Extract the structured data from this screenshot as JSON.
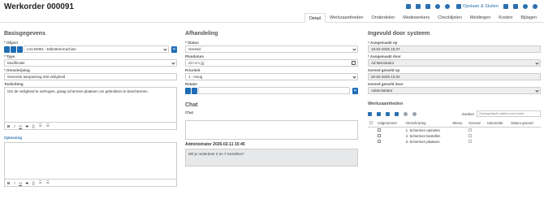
{
  "header": {
    "title": "Werkorder 000091",
    "save_label": "Opslaan & Sluiten",
    "icons": [
      "list-icon",
      "print-icon",
      "mail-icon",
      "phone-icon",
      "check-icon",
      "save-icon",
      "delete-icon",
      "undo-icon",
      "refresh-icon"
    ]
  },
  "tabs": [
    "Detail",
    "Werkzaamheden",
    "Onderdelen",
    "Medewerkers",
    "Checklijsten",
    "Meldingen",
    "Kosten",
    "Bijlagen"
  ],
  "basis": {
    "heading": "Basisgegevens",
    "object_label": "Object",
    "object_value": "L01-EM01 - Etiketteermachine",
    "type_label": "Type",
    "type_value": "Modificatie",
    "omschrijving_label": "Omschrijving",
    "omschrijving_value": "Geverste aanpassing mbt veiligheid",
    "toelichting_label": "Toelichting",
    "toelichting_value": "Om de veiligheid te verhogen, graag schermen plaatsen om gebruikers te beschermen.",
    "oplossing_label": "Oplossing",
    "rte": [
      "B",
      "I",
      "U",
      "S",
      "{}",
      "☰",
      "☰"
    ]
  },
  "afhandeling": {
    "heading": "Afhandeling",
    "status_label": "Status",
    "status_value": "Gereed",
    "planddatum_label": "Plandatum",
    "planddatum_value": "dd-mm-jjjj",
    "prioriteit_label": "Prioriteit",
    "prioriteit_value": "1 - Hoog",
    "relatie_label": "Relatie",
    "chat_heading": "Chat",
    "chat_label": "Chat",
    "admin_line": "Administrator 2025-02-11 15:45",
    "message": "Wil je onderdeel X en Y bestellen?"
  },
  "systeem": {
    "heading": "Ingevuld door systeem",
    "aangemaakt_op_label": "Aangemaakt op",
    "aangemaakt_op_value": "18-02-2025 15:37",
    "aangemaakt_door_label": "Aangemaakt door",
    "aangemaakt_door_value": "Ad Menstrator",
    "gereed_op_label": "Gereed gemeld op",
    "gereed_op_value": "20-02-2025 12:02",
    "gereed_door_label": "Gereed gemeld door",
    "gereed_door_value": "Administrator"
  },
  "werk": {
    "heading": "Werkzaamheden",
    "zoeken_label": "Zoeken",
    "zoeken_placeholder": "Zoekopdracht starten met enter ...",
    "columns": [
      "Volgnummer",
      "Omschrijving",
      "Memo",
      "Gereed",
      "Uitvoerder",
      "Datum gereed"
    ],
    "rows": [
      {
        "nr": "1",
        "omschrijving": "Schermen opmeten"
      },
      {
        "nr": "2",
        "omschrijving": "Schermen bestellen"
      },
      {
        "nr": "3",
        "omschrijving": "Schermen plaatsen"
      }
    ]
  }
}
